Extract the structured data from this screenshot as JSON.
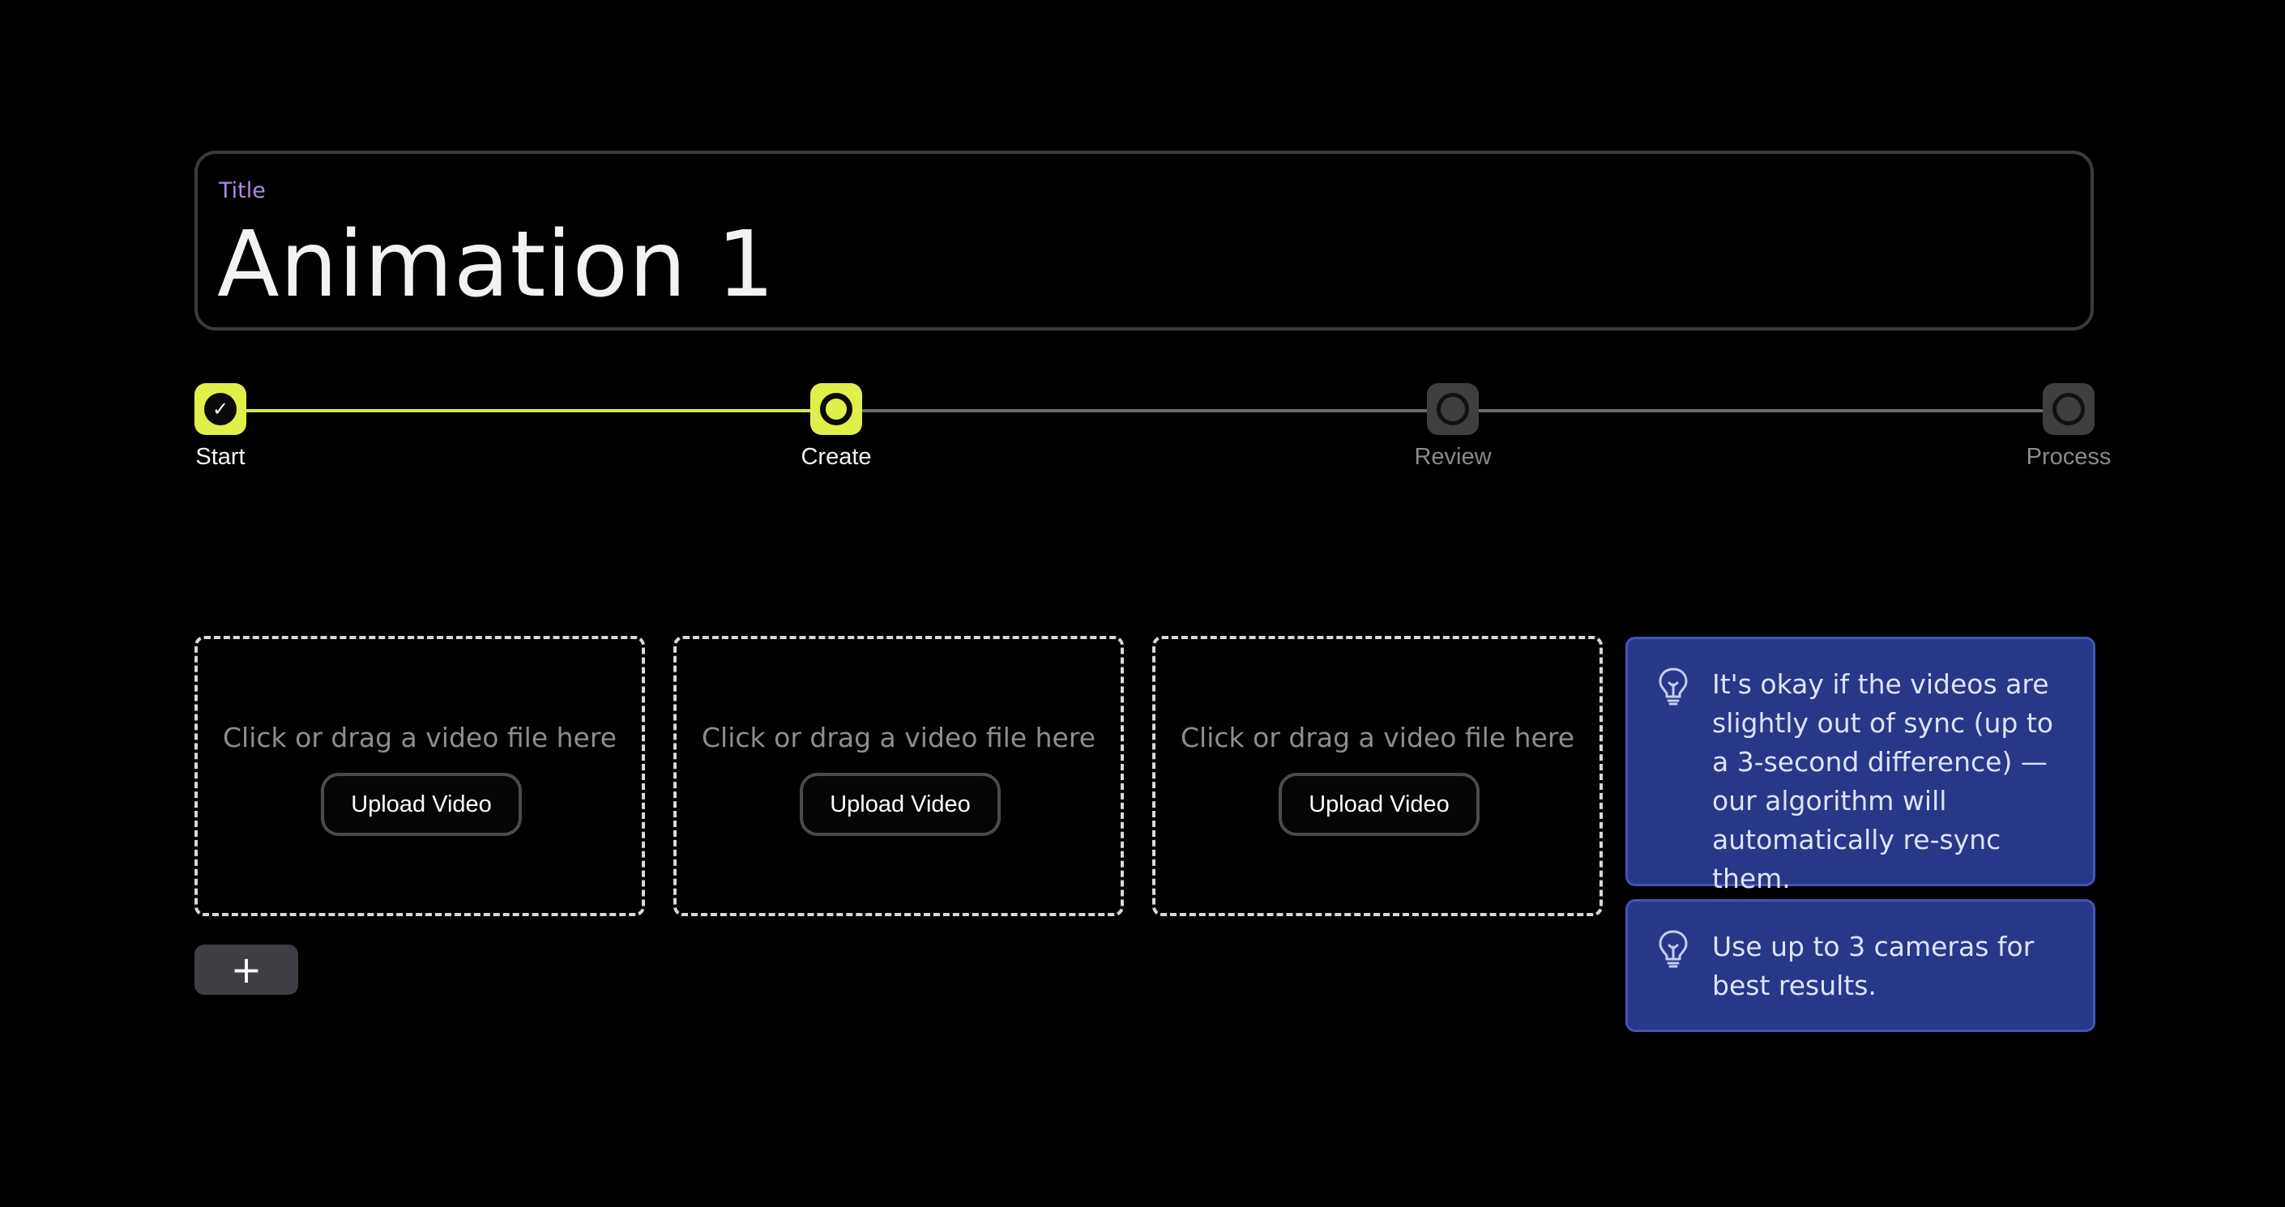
{
  "title": {
    "label": "Title",
    "value": "Animation 1"
  },
  "stepper": {
    "steps": [
      {
        "label": "Start",
        "status": "done"
      },
      {
        "label": "Create",
        "status": "current"
      },
      {
        "label": "Review",
        "status": "pending"
      },
      {
        "label": "Process",
        "status": "pending"
      }
    ]
  },
  "uploads": [
    {
      "prompt": "Click or drag a video file here",
      "button": "Upload Video"
    },
    {
      "prompt": "Click or drag a video file here",
      "button": "Upload Video"
    },
    {
      "prompt": "Click or drag a video file here",
      "button": "Upload Video"
    }
  ],
  "add_button": {
    "icon": "plus-icon",
    "glyph": "+"
  },
  "tips": [
    {
      "icon": "lightbulb-icon",
      "text": "It's okay if the videos are slightly out of sync (up to a 3-second difference) — our algorithm will automatically re-sync them."
    },
    {
      "icon": "lightbulb-icon",
      "text": "Use up to 3 cameras for best results."
    }
  ],
  "colors": {
    "accent": "#dff04a",
    "tip_background": "#283787",
    "title_label": "#a98be0"
  }
}
